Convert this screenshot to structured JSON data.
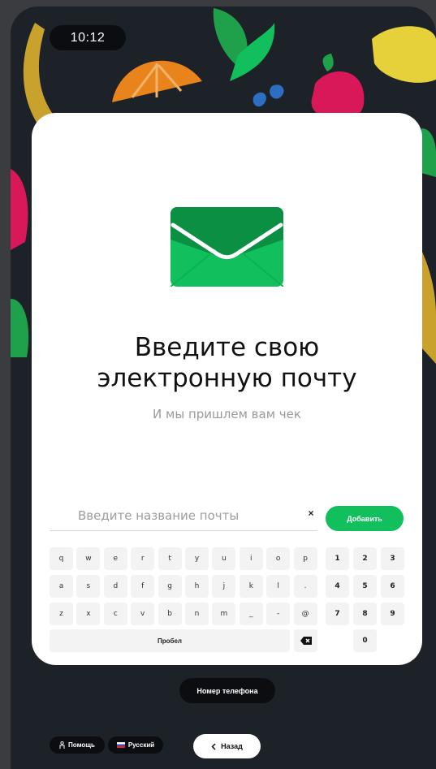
{
  "status_bar": {
    "time": "10:12"
  },
  "card": {
    "icon": "envelope-icon",
    "title": "Введите свою\nэлектронную почту",
    "subtitle": "И мы пришлем вам чек"
  },
  "email": {
    "value": "",
    "placeholder": "Введите название почты",
    "clear_label": "×",
    "add_button": "Добавить"
  },
  "keyboard": {
    "rows": [
      [
        "q",
        "w",
        "e",
        "r",
        "t",
        "y",
        "u",
        "i",
        "o",
        "p"
      ],
      [
        "a",
        "s",
        "d",
        "f",
        "g",
        "h",
        "j",
        "k",
        "l",
        "."
      ],
      [
        "z",
        "x",
        "c",
        "v",
        "b",
        "n",
        "m",
        "_",
        "-",
        "@"
      ]
    ],
    "numpad": [
      [
        "1",
        "2",
        "3"
      ],
      [
        "4",
        "5",
        "6"
      ],
      [
        "7",
        "8",
        "9"
      ],
      [
        "0"
      ]
    ],
    "space_label": "Пробел",
    "backspace_icon": "backspace-icon"
  },
  "phone_button": "Номер телефона",
  "footer": {
    "help_label": "Помощь",
    "help_icon": "person-icon",
    "language_label": "Русский",
    "language_icon": "russian-flag-icon",
    "back_label": "Назад",
    "back_icon": "chevron-left-icon"
  },
  "colors": {
    "accent": "#11bf5c",
    "background": "#1d2229",
    "card": "#ffffff"
  }
}
